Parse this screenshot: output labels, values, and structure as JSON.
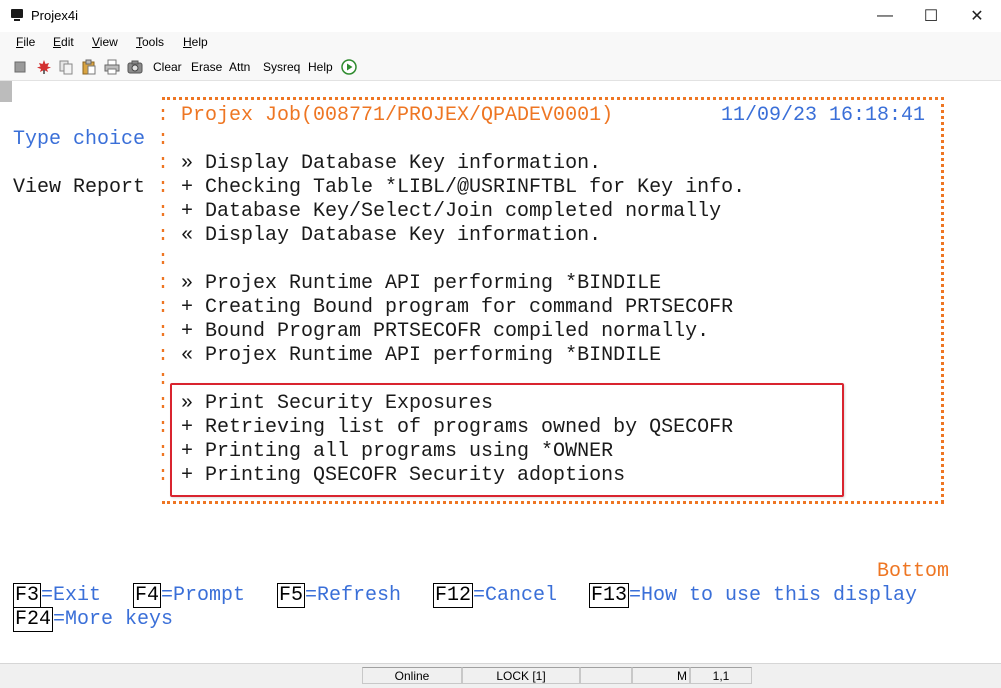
{
  "window": {
    "title": "Projex4i",
    "minimize_glyph": "—",
    "maximize_glyph": "☐",
    "close_glyph": "✕"
  },
  "menu": {
    "file": {
      "first": "F",
      "rest": "ile"
    },
    "edit": {
      "first": "E",
      "rest": "dit"
    },
    "view": {
      "first": "V",
      "rest": "iew"
    },
    "tools": {
      "first": "T",
      "rest": "ools"
    },
    "help": {
      "first": "H",
      "rest": "elp"
    }
  },
  "toolbar": {
    "icons": [
      "block-icon",
      "leaf-icon",
      "copy-icon",
      "paste-icon",
      "print-icon",
      "camera-icon",
      "play-icon"
    ],
    "buttons": {
      "clear": "Clear",
      "erase": "Erase",
      "attn": "Attn",
      "sysreq": "Sysreq",
      "help": "Help"
    }
  },
  "screen": {
    "prompt": "Type choice",
    "option": "View Report",
    "window_title": "Projex Job(008771/PROJEX/QPADEV0001)",
    "datetime": "11/09/23 16:18:41",
    "separator": ":",
    "messages": [
      "» Display Database Key information.",
      "+ Checking Table *LIBL/@USRINFTBL for Key info.",
      "+ Database Key/Select/Join completed normally",
      "« Display Database Key information.",
      "",
      "» Projex Runtime API performing *BINDILE",
      "+ Creating Bound program for command PRTSECOFR",
      "+ Bound Program PRTSECOFR compiled normally.",
      "« Projex Runtime API performing *BINDILE",
      "",
      "» Print Security Exposures",
      "+ Retrieving list of programs owned by QSECOFR",
      "+ Printing all programs using *OWNER",
      "+ Printing QSECOFR Security adoptions"
    ],
    "more_indicator": "Bottom",
    "fkeys_row1": [
      {
        "key": "F3",
        "label": "=Exit"
      },
      {
        "key": "F4",
        "label": "=Prompt"
      },
      {
        "key": "F5",
        "label": "=Refresh"
      },
      {
        "key": "F12",
        "label": "=Cancel"
      },
      {
        "key": "F13",
        "label": "=How to use this display"
      }
    ],
    "fkeys_row2": [
      {
        "key": "F24",
        "label": "=More keys"
      }
    ]
  },
  "status": {
    "connection": "Online",
    "lock": "LOCK [1]",
    "mode": "M",
    "cursor": "1,1"
  },
  "colors": {
    "field_blue": "#3a6fd8",
    "window_orange": "#ee7623",
    "highlight_red": "#d9242f"
  }
}
